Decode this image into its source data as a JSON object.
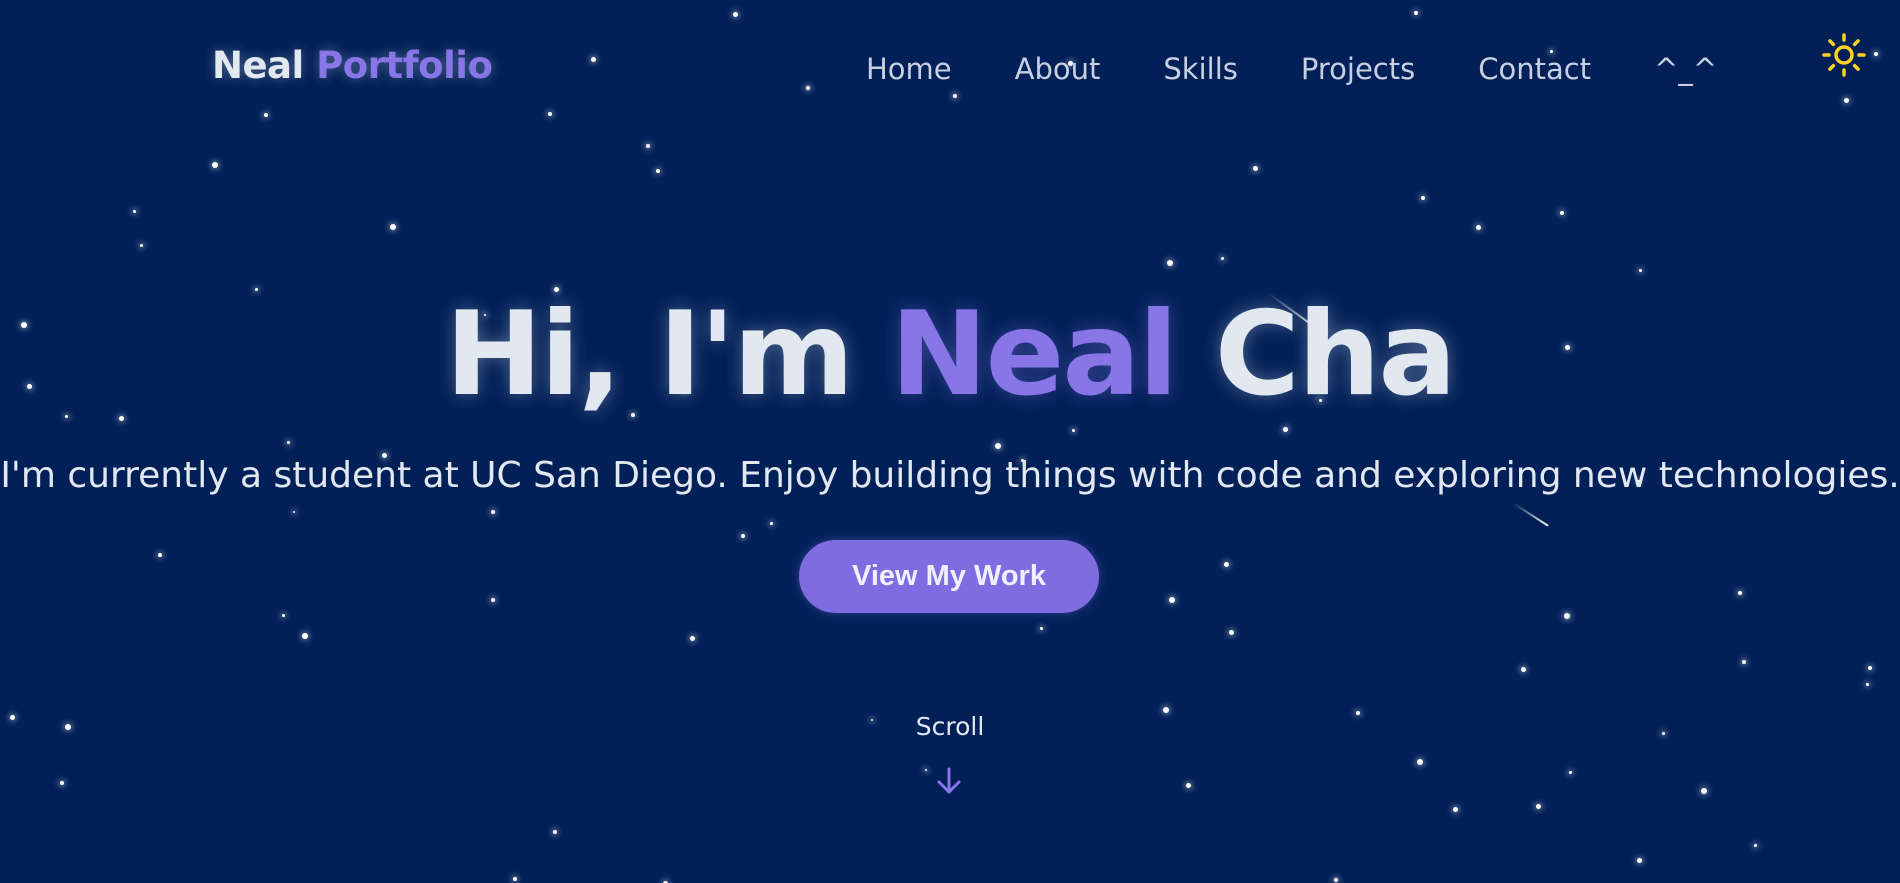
{
  "nav": {
    "logo_first": "Neal",
    "logo_second": "Portfolio",
    "links": [
      {
        "label": "Home"
      },
      {
        "label": "About"
      },
      {
        "label": "Skills"
      },
      {
        "label": "Projects"
      },
      {
        "label": "Contact"
      },
      {
        "label": "^_^"
      }
    ],
    "theme_icon": "sun-icon"
  },
  "hero": {
    "greeting": "Hi, I'm",
    "name": "Neal",
    "last_name": "Cha",
    "subtitle": "I'm currently a student at UC San Diego. Enjoy building things with code and exploring new technologies.",
    "cta_label": "View My Work"
  },
  "scroll": {
    "label": "Scroll",
    "icon": "arrow-down-icon"
  },
  "colors": {
    "background": "#022058",
    "accent": "#8875e6",
    "button": "#7f6ce0",
    "text": "#e2e8f0",
    "sun": "#ffd21f"
  }
}
